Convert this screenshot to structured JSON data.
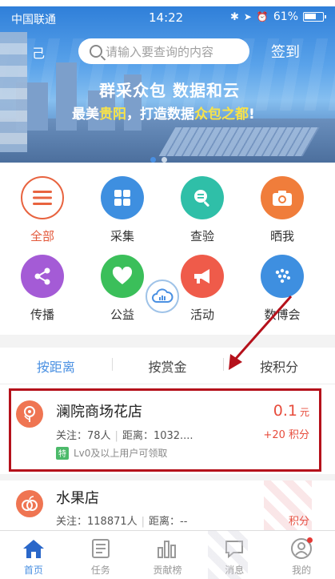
{
  "status": {
    "carrier": "中国联通",
    "time": "14:22",
    "battery": "61%"
  },
  "header": {
    "search_placeholder": "请输入要查询的内容",
    "signin": "签到",
    "left_label": "己"
  },
  "banner": {
    "slogan_main": "群采众包 数据和云",
    "slogan_sub_a": "最美",
    "slogan_sub_city": "贵阳",
    "slogan_sub_b": "，打造数据",
    "slogan_sub_hl": "众包之都",
    "slogan_sub_end": "!"
  },
  "categories": [
    {
      "label": "全部",
      "icon": "menu-icon",
      "color": "#e8633f"
    },
    {
      "label": "采集",
      "icon": "grid-icon",
      "color": "#3e8fe0"
    },
    {
      "label": "查验",
      "icon": "magnifier-icon",
      "color": "#2fbfa8"
    },
    {
      "label": "晒我",
      "icon": "camera-icon",
      "color": "#f07d3b"
    },
    {
      "label": "传播",
      "icon": "share-icon",
      "color": "#a45bd6"
    },
    {
      "label": "公益",
      "icon": "heart-icon",
      "color": "#3bbf5a"
    },
    {
      "label": "活动",
      "icon": "megaphone-icon",
      "color": "#ef5b4a"
    },
    {
      "label": "数博会",
      "icon": "expo-icon",
      "color": "#3e8fe0"
    }
  ],
  "tabs": [
    "按距离",
    "按赏金",
    "按积分"
  ],
  "list": [
    {
      "name": "澜院商场花店",
      "follow": "关注：78人",
      "distance": "距离：1032....",
      "price": "0.1",
      "unit": "元",
      "points": "+20 积分",
      "badge_mark": "特",
      "badge_text": "Lv0及以上用户可领取"
    },
    {
      "name": "水果店",
      "follow": "关注：118871人",
      "distance": "距离：--",
      "points": "积分"
    }
  ],
  "nav": [
    {
      "label": "首页",
      "icon": "home-icon"
    },
    {
      "label": "任务",
      "icon": "task-icon"
    },
    {
      "label": "贡献榜",
      "icon": "bar-chart-icon"
    },
    {
      "label": "消息",
      "icon": "message-icon"
    },
    {
      "label": "我的",
      "icon": "user-icon"
    }
  ],
  "colors": {
    "accent": "#4a90e2",
    "price": "#e74c3c",
    "annotation": "#b5111b"
  }
}
